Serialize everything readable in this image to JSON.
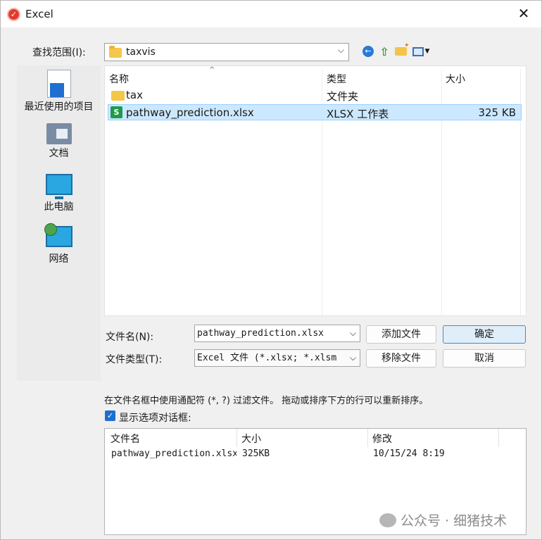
{
  "window": {
    "title": "Excel",
    "close": "✕"
  },
  "lookin": {
    "label": "查找范围(I):",
    "value": "taxvis"
  },
  "toolbar": {
    "back": "back-icon",
    "up": "up-folder-icon",
    "new_folder": "new-folder-icon",
    "view": "view-menu-icon"
  },
  "places": [
    {
      "label": "最近使用的项目",
      "icon": "recent-items-icon"
    },
    {
      "label": "文档",
      "icon": "documents-icon"
    },
    {
      "label": "此电脑",
      "icon": "this-pc-icon"
    },
    {
      "label": "网络",
      "icon": "network-icon"
    }
  ],
  "filelist": {
    "columns": [
      "名称",
      "类型",
      "大小"
    ],
    "rows": [
      {
        "name": "tax",
        "type": "文件夹",
        "size": ""
      },
      {
        "name": "pathway_prediction.xlsx",
        "type": "XLSX 工作表",
        "size": "325 KB"
      }
    ]
  },
  "filename": {
    "label": "文件名(N):",
    "value": "pathway_prediction.xlsx"
  },
  "filetype": {
    "label": "文件类型(T):",
    "value": "Excel 文件 (*.xlsx; *.xlsm"
  },
  "buttons": {
    "add": "添加文件",
    "remove": "移除文件",
    "ok": "确定",
    "cancel": "取消"
  },
  "hint": "在文件名框中使用通配符 (*, ?) 过滤文件。 拖动或排序下方的行可以重新排序。",
  "options": {
    "label": "显示选项对话框:",
    "checked": true
  },
  "selected_table": {
    "columns": [
      "文件名",
      "大小",
      "修改"
    ],
    "rows": [
      {
        "name": "pathway_prediction.xlsx",
        "size": "325KB",
        "modified": "10/15/24 8:19"
      }
    ]
  },
  "watermark": "公众号 · 细猪技术"
}
